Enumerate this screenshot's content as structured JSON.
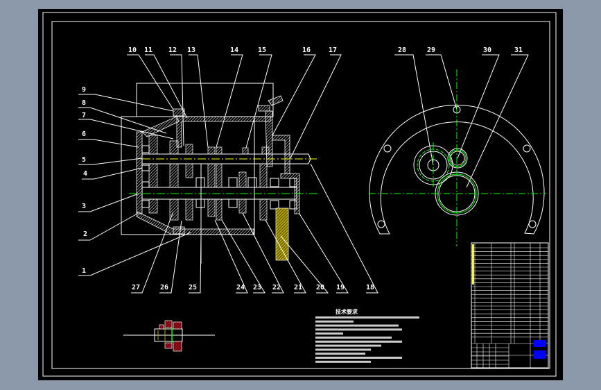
{
  "colors": {
    "background": "#8b98aa",
    "sheet": "#000000",
    "lines": "#ffffff",
    "centerline_green": "#00ff00",
    "centerline_yellow": "#ffff00",
    "hatch_red": "#ff2060",
    "title_block_blue": "#0000ff"
  },
  "labels_left": [
    "9",
    "8",
    "7",
    "6",
    "5",
    "4",
    "3",
    "2",
    "1"
  ],
  "labels_top": [
    "10",
    "11",
    "12",
    "13",
    "14",
    "15",
    "16",
    "17"
  ],
  "labels_bottom": [
    "27",
    "26",
    "25",
    "24",
    "23",
    "22",
    "21",
    "20",
    "19",
    "18"
  ],
  "labels_side_view": [
    "28",
    "29",
    "30",
    "31"
  ],
  "technical_requirements": {
    "title": "技术要求",
    "line_count": 12
  }
}
